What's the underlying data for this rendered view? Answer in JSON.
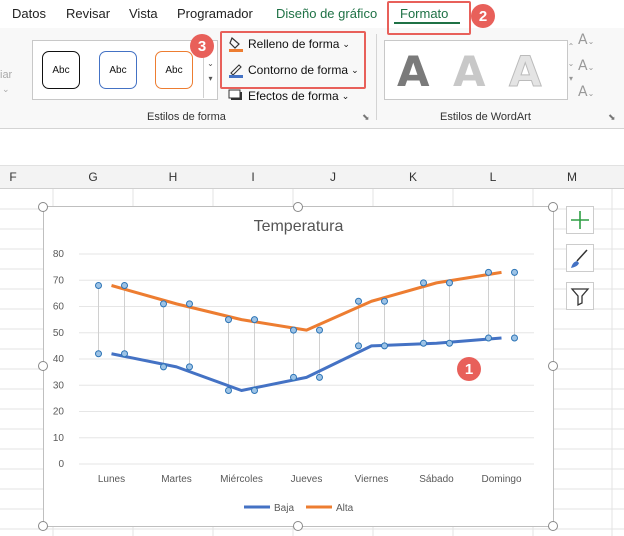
{
  "tabs": [
    {
      "label": "Datos"
    },
    {
      "label": "Revisar"
    },
    {
      "label": "Vista"
    },
    {
      "label": "Programador"
    },
    {
      "label": "Diseño de gráfico"
    },
    {
      "label": "Formato"
    }
  ],
  "ribbon": {
    "shape_styles": {
      "sample_label": "Abc",
      "fill_label": "Relleno de forma",
      "outline_label": "Contorno de forma",
      "effects_label": "Efectos de forma",
      "group_label": "Estilos de forma"
    },
    "wordart": {
      "letter": "A",
      "group_label": "Estilos de WordArt"
    },
    "cropped_label": "iar"
  },
  "badges": [
    "1",
    "2",
    "3"
  ],
  "column_headers": [
    "F",
    "G",
    "H",
    "I",
    "J",
    "K",
    "L",
    "M"
  ],
  "chart_data": {
    "type": "line",
    "title": "Temperatura",
    "categories": [
      "Lunes",
      "Martes",
      "Miércoles",
      "Jueves",
      "Viernes",
      "Sábado",
      "Domingo"
    ],
    "series": [
      {
        "name": "Baja",
        "values": [
          42,
          37,
          28,
          33,
          45,
          46,
          48
        ],
        "color": "#4472c4"
      },
      {
        "name": "Alta",
        "values": [
          68,
          61,
          55,
          51,
          62,
          69,
          73
        ],
        "color": "#ed7d31"
      }
    ],
    "ylim": [
      0,
      80
    ],
    "yticks": [
      0,
      10,
      20,
      30,
      40,
      50,
      60,
      70,
      80
    ],
    "grid": true,
    "legend": "bottom",
    "annotation": "drop lines between series"
  },
  "colors": {
    "accent_green": "#1e7145",
    "highlight_red": "#e8605a",
    "gridline": "#e6e6e6"
  },
  "side_icons": [
    "chart-elements-plus-icon",
    "chart-styles-brush-icon",
    "chart-filter-icon"
  ]
}
